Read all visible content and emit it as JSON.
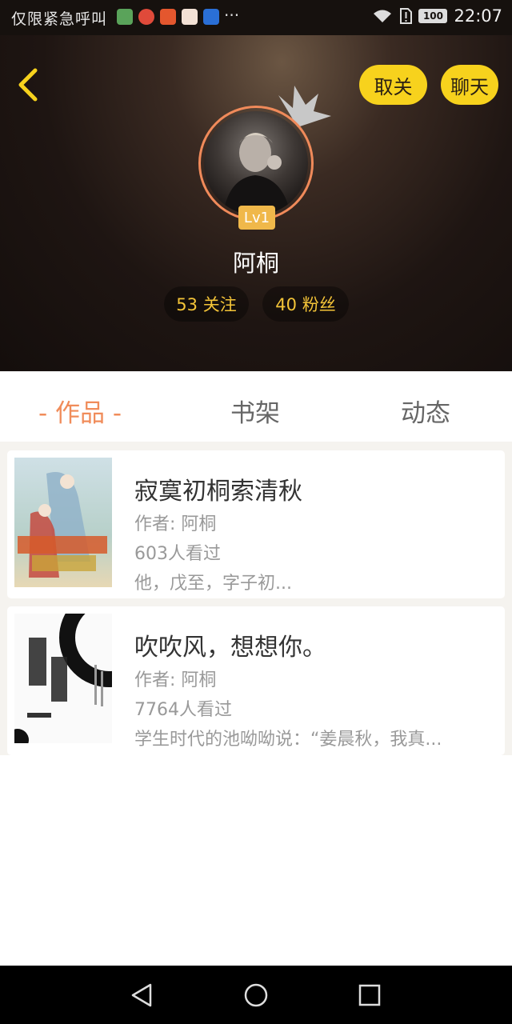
{
  "status_bar": {
    "carrier_text": "仅限紧急呼叫",
    "more": "···",
    "battery": "100",
    "time": "22:07"
  },
  "header": {
    "unfollow_label": "取关",
    "chat_label": "聊天",
    "level": "Lv1",
    "nickname": "阿桐",
    "following": "53 关注",
    "fans": "40 粉丝"
  },
  "tabs": [
    {
      "label": "- 作品 -",
      "active": true
    },
    {
      "label": "书架",
      "active": false
    },
    {
      "label": "动态",
      "active": false
    }
  ],
  "books": [
    {
      "title": "寂寞初桐索清秋",
      "author": "作者: 阿桐",
      "views": "603人看过",
      "description": "他，戊至，字子初..."
    },
    {
      "title": "吹吹风，想想你。",
      "author": "作者: 阿桐",
      "views": "7764人看过",
      "description": "学生时代的池呦呦说：“姜晨秋，我真..."
    }
  ],
  "colors": {
    "accent": "#f7d21d",
    "active_tab": "#f08c5a",
    "stat_text": "#f4c438"
  }
}
